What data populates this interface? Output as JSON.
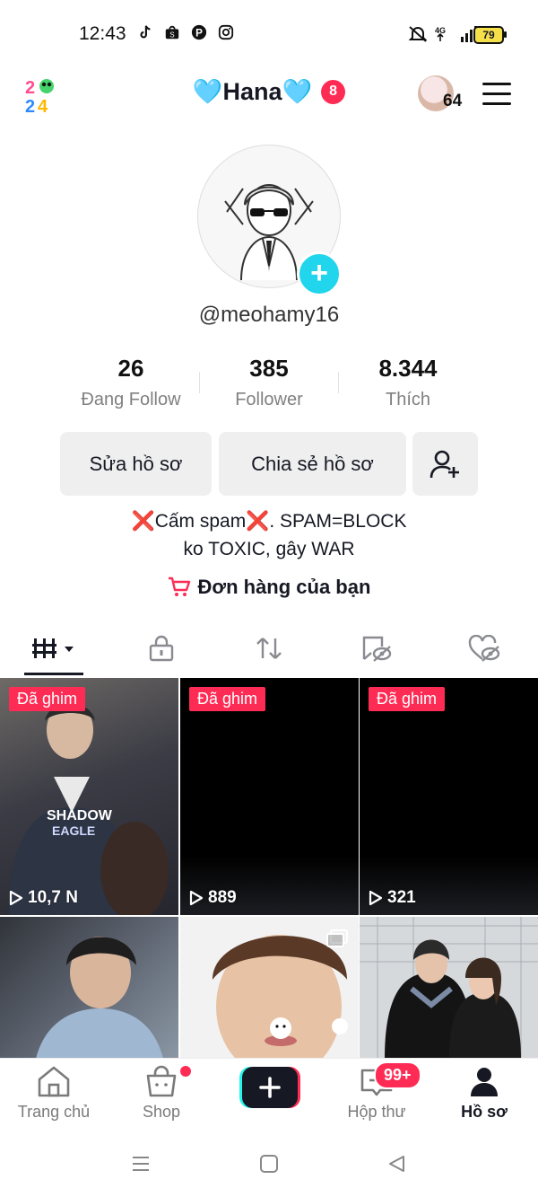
{
  "status_bar": {
    "time": "12:43",
    "left_icons": [
      "tiktok-icon",
      "shopee-icon",
      "pinterest-icon",
      "instagram-icon"
    ],
    "right_icons": [
      "mute-icon",
      "4g-icon",
      "signal-icon"
    ],
    "battery": "79"
  },
  "header": {
    "logo_icon": "2024-logo-icon",
    "title": "🩵Hana🩵",
    "notification_count": "8",
    "avatar_count": "64",
    "menu_icon": "hamburger-menu-icon"
  },
  "profile": {
    "username": "@meohamy16",
    "stats": [
      {
        "value": "26",
        "label": "Đang Follow"
      },
      {
        "value": "385",
        "label": "Follower"
      },
      {
        "value": "8.344",
        "label": "Thích"
      }
    ],
    "buttons": {
      "edit": "Sửa hồ sơ",
      "share": "Chia sẻ hồ sơ",
      "add_friend_icon": "add-user-icon"
    },
    "bio_line1": "❌Cấm spam❌. SPAM=BLOCK",
    "bio_line2": "ko TOXIC, gây WAR",
    "orders": "Đơn hàng của bạn"
  },
  "tabs": [
    "videos-grid-icon",
    "lock-icon",
    "repost-icon",
    "favorites-icon",
    "liked-icon"
  ],
  "videos": [
    {
      "pinned": "Đã ghim",
      "views": "10,7 N"
    },
    {
      "pinned": "Đã ghim",
      "views": "889"
    },
    {
      "pinned": "Đã ghim",
      "views": "321"
    },
    {
      "pinned": "",
      "views": ""
    },
    {
      "pinned": "",
      "views": ""
    },
    {
      "pinned": "",
      "views": ""
    }
  ],
  "bottom_nav": {
    "home": "Trang chủ",
    "shop": "Shop",
    "inbox": "Hộp thư",
    "inbox_badge": "99+",
    "profile": "Hồ sơ"
  },
  "colors": {
    "accent_red": "#fe2c55",
    "accent_cyan": "#20d5ec",
    "text": "#161823",
    "muted": "#808080"
  }
}
